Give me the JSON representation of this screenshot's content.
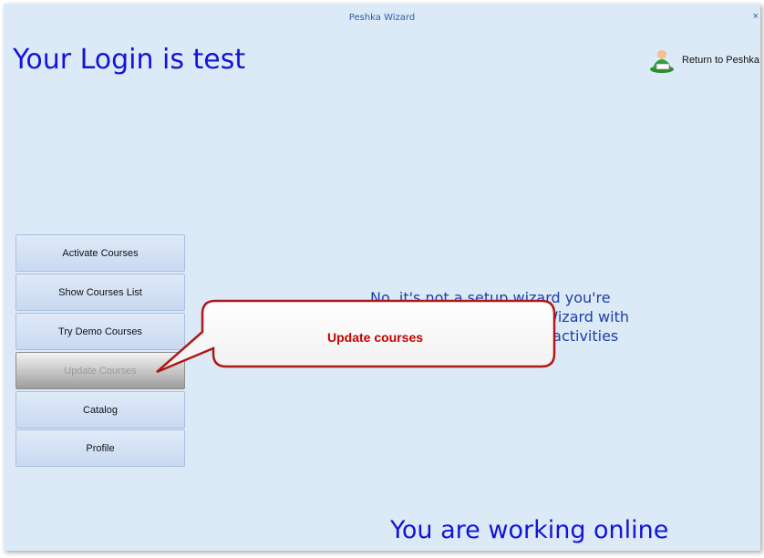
{
  "window": {
    "title": "Peshka Wizard",
    "close_glyph": "×"
  },
  "header": {
    "login_title": "Your Login is test",
    "return_link": {
      "label": "Return to Peshka",
      "icon": "user-reading-icon"
    }
  },
  "sidebar": {
    "items": [
      {
        "label": "Activate Courses",
        "active": false
      },
      {
        "label": "Show Courses List",
        "active": false
      },
      {
        "label": "Try Demo Courses",
        "active": false
      },
      {
        "label": "Update Courses",
        "active": true
      },
      {
        "label": "Catalog",
        "active": false
      },
      {
        "label": "Profile",
        "active": false
      }
    ]
  },
  "main": {
    "description": "No, it's not a setup wizard you're looking for. It's Peshk@ Wizard with useful things for all your activities with Peshk@."
  },
  "callout": {
    "text": "Update courses",
    "text_color": "#c80000"
  },
  "status": {
    "text": "You are working online"
  },
  "colors": {
    "window_bg": "#dce9f7",
    "title_blue": "#1414d6",
    "desc_blue": "#1b3fa8"
  }
}
